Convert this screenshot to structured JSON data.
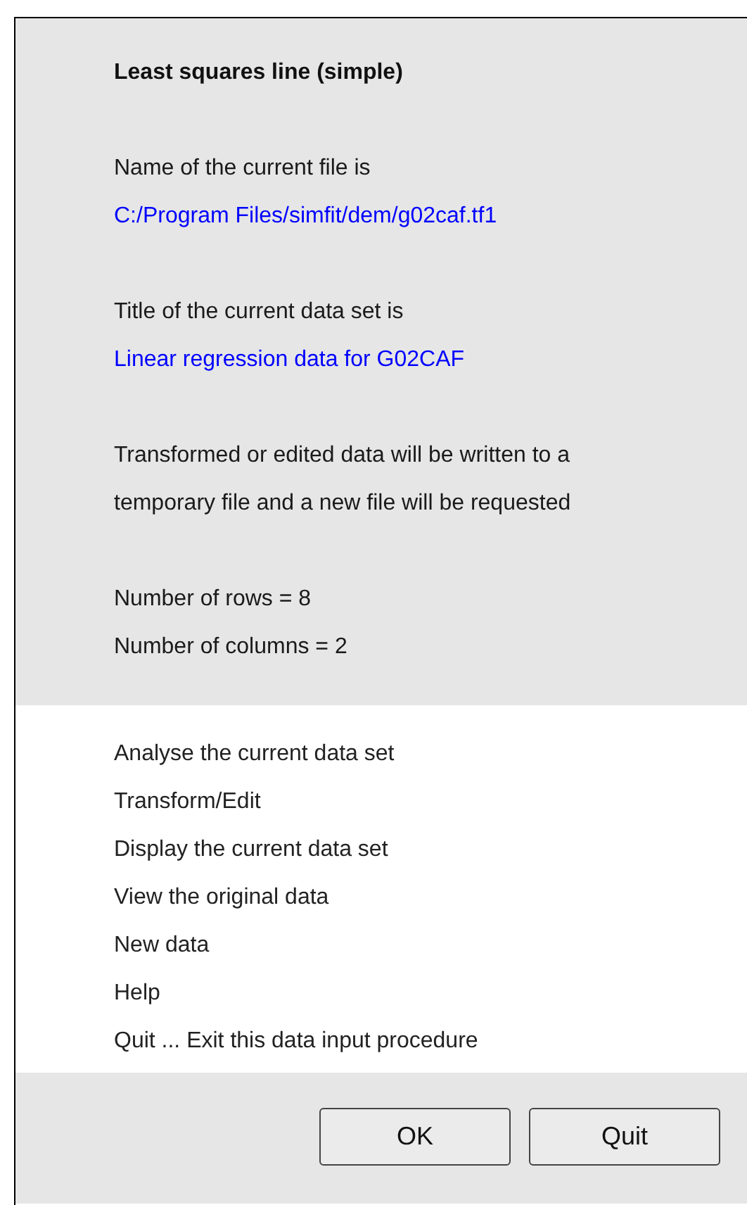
{
  "title": "Least squares line (simple)",
  "groups": [
    [
      {
        "kind": "label",
        "text": "Name of the current file is"
      },
      {
        "kind": "value",
        "text": "C:/Program Files/simfit/dem/g02caf.tf1"
      }
    ],
    [
      {
        "kind": "label",
        "text": "Title of the current data set is"
      },
      {
        "kind": "value",
        "text": "Linear regression data for G02CAF"
      }
    ],
    [
      {
        "kind": "label",
        "text": "Transformed or edited data will be written to a"
      },
      {
        "kind": "label",
        "text": "temporary file and a new file will be requested"
      }
    ],
    [
      {
        "kind": "label",
        "text": "Number of rows = 8"
      },
      {
        "kind": "label",
        "text": "Number of columns = 2"
      }
    ]
  ],
  "menu_items": [
    "Analyse the current data set",
    "Transform/Edit",
    "Display the current data set",
    "View the original data",
    "New data",
    "Help",
    "Quit ... Exit this data input procedure"
  ],
  "buttons": [
    "OK",
    "Quit"
  ]
}
